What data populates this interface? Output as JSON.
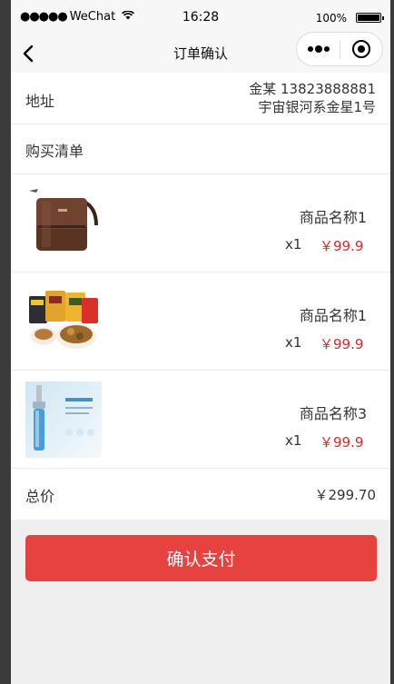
{
  "status_bar": {
    "signal": "●●●●●",
    "carrier": "WeChat",
    "time": "16:28",
    "battery_pct": "100%"
  },
  "navbar": {
    "title": "订单确认"
  },
  "address": {
    "label": "地址",
    "name_phone": "金某 13823888881",
    "detail": "宇宙银河系金星1号"
  },
  "list_label": "购买清单",
  "items": [
    {
      "name": "商品名称1",
      "qty": "x1",
      "price": "￥99.9",
      "image": "brown-leather-bag"
    },
    {
      "name": "商品名称1",
      "qty": "x1",
      "price": "￥99.9",
      "image": "snack-food-packs"
    },
    {
      "name": "商品名称3",
      "qty": "x1",
      "price": "￥99.9",
      "image": "serum-bottle"
    }
  ],
  "total": {
    "label": "总价",
    "value": "￥299.70"
  },
  "pay_button": "确认支付",
  "colors": {
    "accent": "#e64340",
    "price": "#d9282a",
    "background": "#efefef"
  }
}
